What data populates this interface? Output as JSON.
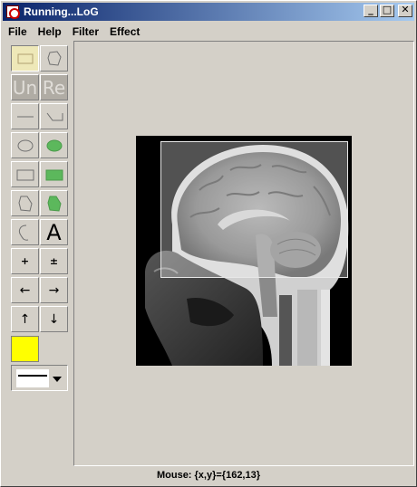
{
  "window": {
    "title": "Running...LoG",
    "minimize_glyph": "_",
    "maximize_glyph": "□",
    "close_glyph": "✕"
  },
  "menu": {
    "items": [
      "File",
      "Help",
      "Filter",
      "Effect"
    ]
  },
  "toolbar": {
    "undo_label": "Un",
    "redo_label": "Re",
    "text_tool_label": "A",
    "zoom_in_label": "+",
    "zoom_toggle_label": "±",
    "left_arrow": "←",
    "right_arrow": "→",
    "up_arrow": "↑",
    "down_arrow": "↓",
    "current_color": "#ffff00"
  },
  "canvas": {
    "image_subject": "sagittal brain MRI scan",
    "has_selection": true
  },
  "status": {
    "mouse_text": "Mouse: {x,y}={162,13}"
  }
}
